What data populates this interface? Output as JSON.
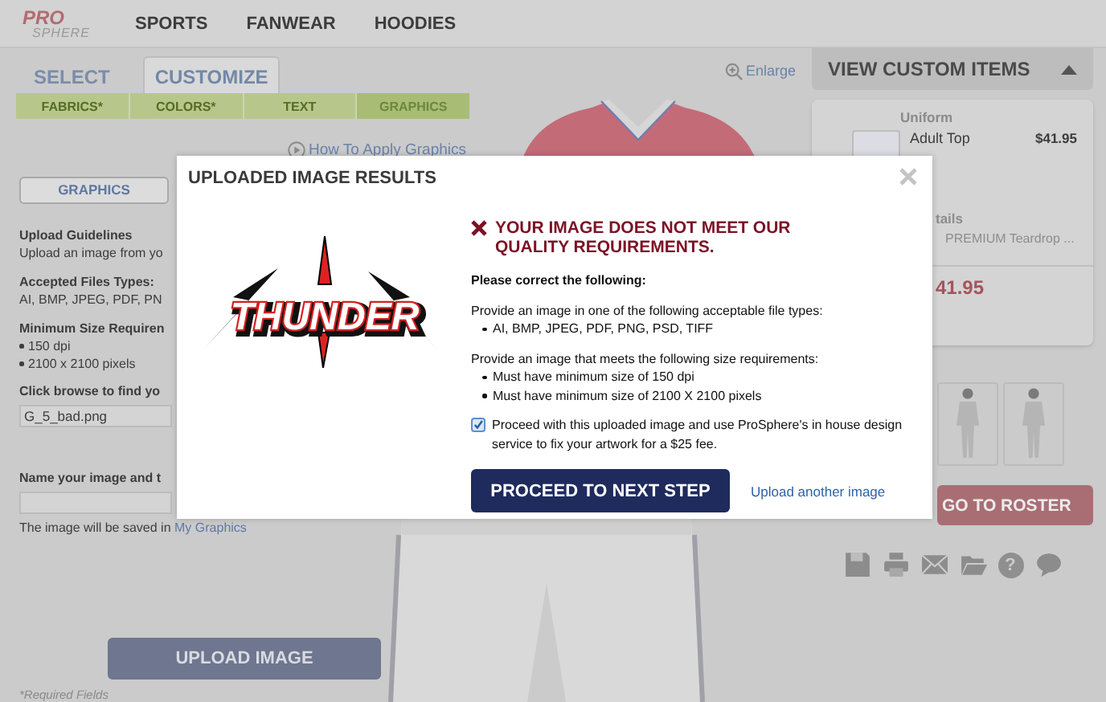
{
  "header": {
    "logo": {
      "line_1": "PRO",
      "line_2": "SPHERE"
    },
    "nav": [
      "SPORTS",
      "FANWEAR",
      "HOODIES"
    ]
  },
  "mode_tabs": [
    {
      "label": "SELECT",
      "selected": false
    },
    {
      "label": "CUSTOMIZE",
      "selected": true
    }
  ],
  "steps": [
    {
      "label": "FABRICS*",
      "selected": false
    },
    {
      "label": "COLORS*",
      "selected": false
    },
    {
      "label": "TEXT",
      "selected": false
    },
    {
      "label": "GRAPHICS",
      "selected": true
    }
  ],
  "help_link": "How To Apply Graphics",
  "enlarge_link": "Enlarge",
  "graphics_panel": {
    "tab": {
      "label": "GRAPHICS",
      "selected": true
    },
    "guidelines_title": "Upload Guidelines",
    "guidelines_text": "Upload an image from yo",
    "types_title": "Accepted Files Types:",
    "types_text": "AI, BMP, JPEG, PDF, PN",
    "size_title": "Minimum Size Requiren",
    "size_items": [
      "150 dpi",
      "2100 x 2100 pixels"
    ],
    "browse_label": "Click browse to find yo",
    "file_value": "G_5_bad.png",
    "name_label": "Name your image and t",
    "save_note": "The image will be saved in",
    "save_link": "My Graphics",
    "upload_button": "UPLOAD IMAGE",
    "required_note": "*Required Fields"
  },
  "custom_items": {
    "header": "VIEW CUSTOM ITEMS",
    "expanded": true,
    "section": "Uniform",
    "item": {
      "name": "Adult Top",
      "price": "$41.95"
    },
    "details_label": "tails",
    "details_value": "PREMIUM Teardrop ...",
    "total": "41.95"
  },
  "roster_button": "GO TO ROSTER",
  "help_glyph": "?",
  "modal": {
    "title": "UPLOADED IMAGE RESULTS",
    "logo_text": "THUNDER",
    "error_title": "YOUR IMAGE DOES NOT MEET OUR QUALITY REQUIREMENTS.",
    "intro": "Please correct the following:",
    "sections": [
      {
        "text": "Provide an image in one of the following acceptable file types:",
        "items": [
          "AI, BMP, JPEG, PDF, PNG, PSD, TIFF"
        ]
      },
      {
        "text": "Provide an image that meets the following size requirements:",
        "items": [
          "Must have minimum size of 150 dpi",
          "Must have minimum size of 2100 X 2100 pixels"
        ]
      }
    ],
    "consent": {
      "label": "Proceed with this uploaded image and use ProSphere's in house design service to fix your artwork for a $25 fee.",
      "checked": true
    },
    "primary_button": "PROCEED TO NEXT STEP",
    "secondary_link": "Upload another image"
  }
}
